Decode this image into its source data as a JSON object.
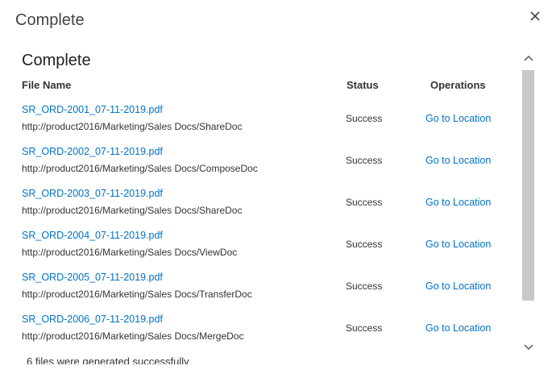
{
  "dialog": {
    "title": "Complete",
    "close_icon": "close-icon"
  },
  "section": {
    "heading": "Complete"
  },
  "columns": {
    "file_name": "File Name",
    "status": "Status",
    "operations": "Operations"
  },
  "rows": [
    {
      "file": "SR_ORD-2001_07-11-2019.pdf",
      "path": "http://product2016/Marketing/Sales Docs/ShareDoc",
      "status": "Success",
      "operation": "Go to Location"
    },
    {
      "file": "SR_ORD-2002_07-11-2019.pdf",
      "path": "http://product2016/Marketing/Sales Docs/ComposeDoc",
      "status": "Success",
      "operation": "Go to Location"
    },
    {
      "file": "SR_ORD-2003_07-11-2019.pdf",
      "path": "http://product2016/Marketing/Sales Docs/ShareDoc",
      "status": "Success",
      "operation": "Go to Location"
    },
    {
      "file": "SR_ORD-2004_07-11-2019.pdf",
      "path": "http://product2016/Marketing/Sales Docs/ViewDoc",
      "status": "Success",
      "operation": "Go to Location"
    },
    {
      "file": "SR_ORD-2005_07-11-2019.pdf",
      "path": "http://product2016/Marketing/Sales Docs/TransferDoc",
      "status": "Success",
      "operation": "Go to Location"
    },
    {
      "file": "SR_ORD-2006_07-11-2019.pdf",
      "path": "http://product2016/Marketing/Sales Docs/MergeDoc",
      "status": "Success",
      "operation": "Go to Location"
    }
  ],
  "summary": "6 files were generated successfully",
  "scrollbar": {
    "up_icon": "chevron-up-icon",
    "down_icon": "chevron-down-icon"
  },
  "colors": {
    "link": "#0072c6",
    "thumb": "#c8c8c8"
  }
}
